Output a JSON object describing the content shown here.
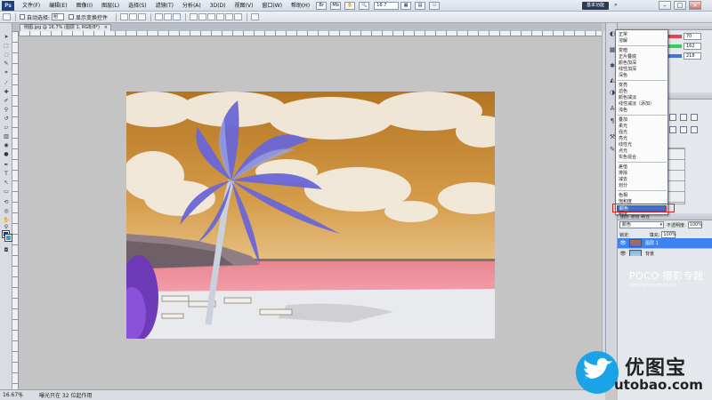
{
  "menubar": {
    "logo": "Ps",
    "items": [
      "文件(F)",
      "编辑(E)",
      "图像(I)",
      "图层(L)",
      "选择(S)",
      "滤镜(T)",
      "分析(A)",
      "3D(D)",
      "视图(V)",
      "窗口(W)",
      "帮助(H)"
    ],
    "zoom": "16.7",
    "workspace_label": "基本功能",
    "workspace_arrow": "»",
    "window_buttons": [
      "–",
      "□",
      "×"
    ]
  },
  "options_bar": {
    "auto_select_label": "自动选择:",
    "auto_select_value": "组",
    "show_transform_label": "显示变换控件"
  },
  "document_tab": {
    "title": "例图.jpg @ 16.7% (图层 1, RGB/8*)",
    "close": "×"
  },
  "status_bar": {
    "zoom": "16.67%",
    "info": "曝光只在 32 位起作用"
  },
  "color_panel": {
    "values": [
      "70",
      "162",
      "218"
    ],
    "colors": [
      "#e8424f",
      "#2bd35a",
      "#3a73e8"
    ]
  },
  "blend_menu": {
    "groups": [
      [
        "正常",
        "溶解"
      ],
      [
        "变暗",
        "正片叠底",
        "颜色加深",
        "线性加深",
        "深色"
      ],
      [
        "变亮",
        "滤色",
        "颜色减淡",
        "线性减淡（添加）",
        "浅色"
      ],
      [
        "叠加",
        "柔光",
        "强光",
        "亮光",
        "线性光",
        "点光",
        "实色混合"
      ],
      [
        "差值",
        "排除",
        "减去",
        "划分"
      ],
      [
        "色相",
        "饱和度"
      ]
    ],
    "selected": "颜色",
    "last": "明度"
  },
  "layers_panel": {
    "tabs": "图层   通道   路径",
    "blend_value": "颜色",
    "blend_arrow": "▾",
    "opacity_label": "不透明度:",
    "opacity_value": "100%",
    "lock_label": "锁定:",
    "fill_label": "填充:",
    "fill_value": "100%",
    "layers": [
      {
        "name": "图层 1",
        "selected": true
      },
      {
        "name": "背景",
        "selected": false
      }
    ]
  },
  "watermarks": {
    "poco_logo": "POCO 摄影专题",
    "poco_url": "http://photo.poco.cn/",
    "site_name": "优图宝",
    "site_domain": "utobao.com"
  }
}
